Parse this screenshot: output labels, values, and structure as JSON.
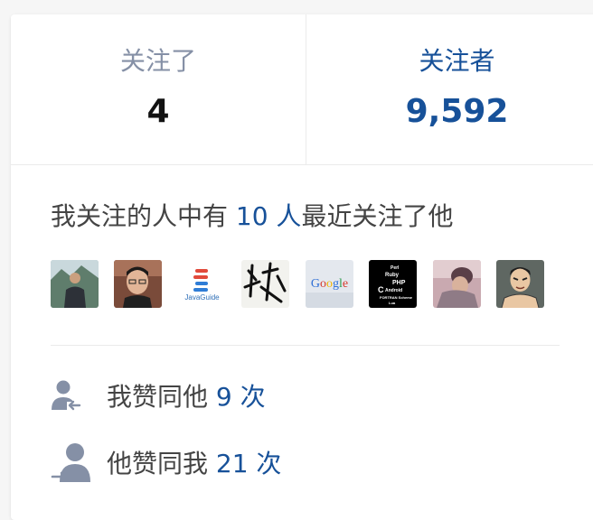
{
  "counts": {
    "following_label": "关注了",
    "following_value": "4",
    "followers_label": "关注者",
    "followers_value": "9,592"
  },
  "mutual": {
    "prefix": "我关注的人中有 ",
    "count": "10 人",
    "suffix": "最近关注了他",
    "avatars": [
      {
        "name": "avatar-1",
        "icon": "person-photo"
      },
      {
        "name": "avatar-2",
        "icon": "person-glasses-photo"
      },
      {
        "name": "avatar-3",
        "icon": "javaguide-logo",
        "text": "JavaGuide"
      },
      {
        "name": "avatar-4",
        "icon": "calligraphy"
      },
      {
        "name": "avatar-5",
        "icon": "google-logo",
        "text": "Google"
      },
      {
        "name": "avatar-6",
        "icon": "typography-poster"
      },
      {
        "name": "avatar-7",
        "icon": "person-photo-blur"
      },
      {
        "name": "avatar-8",
        "icon": "cartoon-avatar"
      }
    ]
  },
  "stats": {
    "liked_him_prefix": "我赞同他 ",
    "liked_him_count": "9 次",
    "liked_me_prefix": "他赞同我 ",
    "liked_me_count": "21 次"
  },
  "colors": {
    "accent": "#175199",
    "muted": "#8590a6",
    "text": "#444444"
  }
}
